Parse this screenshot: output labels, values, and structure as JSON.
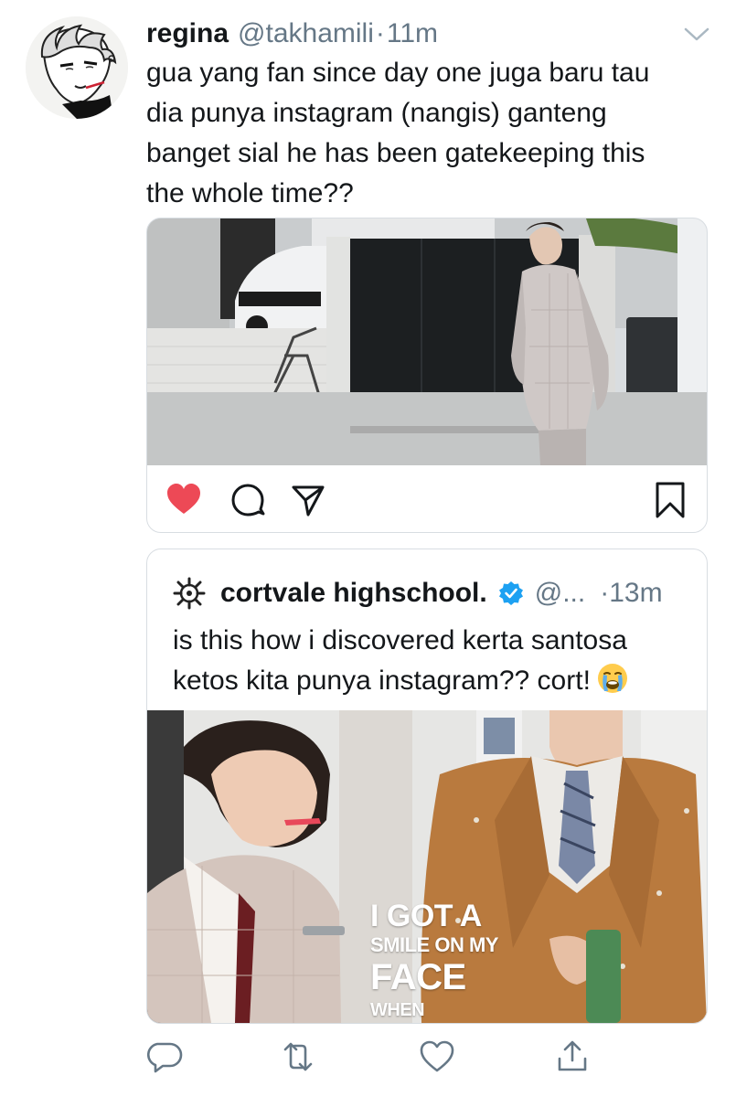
{
  "tweet": {
    "display_name": "regina",
    "handle": "@takhamili",
    "separator": "·",
    "time": "11m",
    "text": "gua yang fan since day one juga baru tau\ndia punya instagram (nangis) ganteng\nbanget sial he has been gatekeeping this\nthe whole time??"
  },
  "instagram_card": {
    "liked": true,
    "icons": [
      "heart-icon",
      "comment-icon",
      "share-icon",
      "bookmark-icon"
    ],
    "accent_color": "#ed4956"
  },
  "quoted_tweet": {
    "display_name": "cortvale highschool.",
    "verified": true,
    "handle": "@...",
    "separator": "·",
    "time": "13m",
    "text": "is this how i discovered kerta santosa\nketos kita punya instagram?? cort!",
    "emoji": "loudly-crying-face",
    "media_overlay": [
      "I GOT A",
      "SMILE ON MY",
      "FACE",
      "WHEN"
    ]
  },
  "actions": {
    "icons": [
      "reply-icon",
      "retweet-icon",
      "like-icon",
      "share-icon"
    ],
    "icon_color": "#657786"
  },
  "colors": {
    "text": "#14171a",
    "secondary": "#657786",
    "border": "#d8dde2",
    "verified_blue": "#1da1f2"
  }
}
